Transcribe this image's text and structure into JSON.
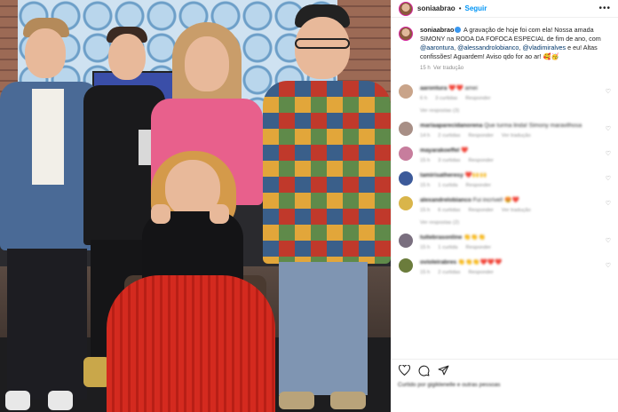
{
  "post": {
    "username": "soniaabrao",
    "follow_label": "Seguir",
    "caption_user": "soniaabrao",
    "caption_text_1": " A gravação de hoje foi com ela! Nossa amada ",
    "caption_bold_1": "SIMONY",
    "caption_text_2": " na ",
    "caption_bold_2": "RODA DA FOFOCA ESPECIAL",
    "caption_text_3": " de fim de ano, com ",
    "mention_1": "@aarontura",
    "mention_2": "@alessandrolobianco",
    "mention_3": "@vladimiralves",
    "caption_text_4": " e eu! Altas confissões! Aguardem! Aviso qdo for ao ar! 🥰🥳",
    "caption_time": "15 h",
    "translate_label": "Ver tradução"
  },
  "comments": [
    {
      "user": "aarontura",
      "text": "❤️❤️ amei",
      "time": "6 h",
      "likes": "3 curtidas",
      "reply": "Responder",
      "avatar_color": "#c9a48a",
      "replies": "Ver respostas (3)"
    },
    {
      "user": "mariaaparecidanorena",
      "text": "Que turma linda! Simony maravilhosa",
      "time": "14 h",
      "likes": "2 curtidas",
      "reply": "Responder",
      "translate": "Ver tradução",
      "avatar_color": "#a88f86",
      "replies": ""
    },
    {
      "user": "mayarakoeffel",
      "text": "❤️",
      "time": "15 h",
      "likes": "3 curtidas",
      "reply": "Responder",
      "avatar_color": "#c77d9d",
      "replies": ""
    },
    {
      "user": "tamirisatheresy",
      "text": "❤️🙌🙌",
      "time": "15 h",
      "likes": "1 curtida",
      "reply": "Responder",
      "avatar_color": "#3c5a9a",
      "replies": ""
    },
    {
      "user": "alexandrelobianco",
      "text": "Fui incrível! 😍❤️",
      "time": "15 h",
      "likes": "6 curtidas",
      "reply": "Responder",
      "translate": "Ver tradução",
      "avatar_color": "#d9b54a",
      "replies": "Ver respostas (2)"
    },
    {
      "user": "tuitebrasonline",
      "text": "👏👏👏",
      "time": "15 h",
      "likes": "1 curtida",
      "reply": "Responder",
      "avatar_color": "#7a6f7f",
      "replies": ""
    },
    {
      "user": "ovioleirabres",
      "text": "👏👏👏❤️❤️❤️",
      "time": "15 h",
      "likes": "2 curtidas",
      "reply": "Responder",
      "avatar_color": "#6b7c3c",
      "replies": ""
    }
  ],
  "footer": {
    "likes_text": "Curtido por gigiklenelle e outras pessoas",
    "icons": [
      "heart-icon",
      "comment-icon",
      "share-icon"
    ]
  }
}
